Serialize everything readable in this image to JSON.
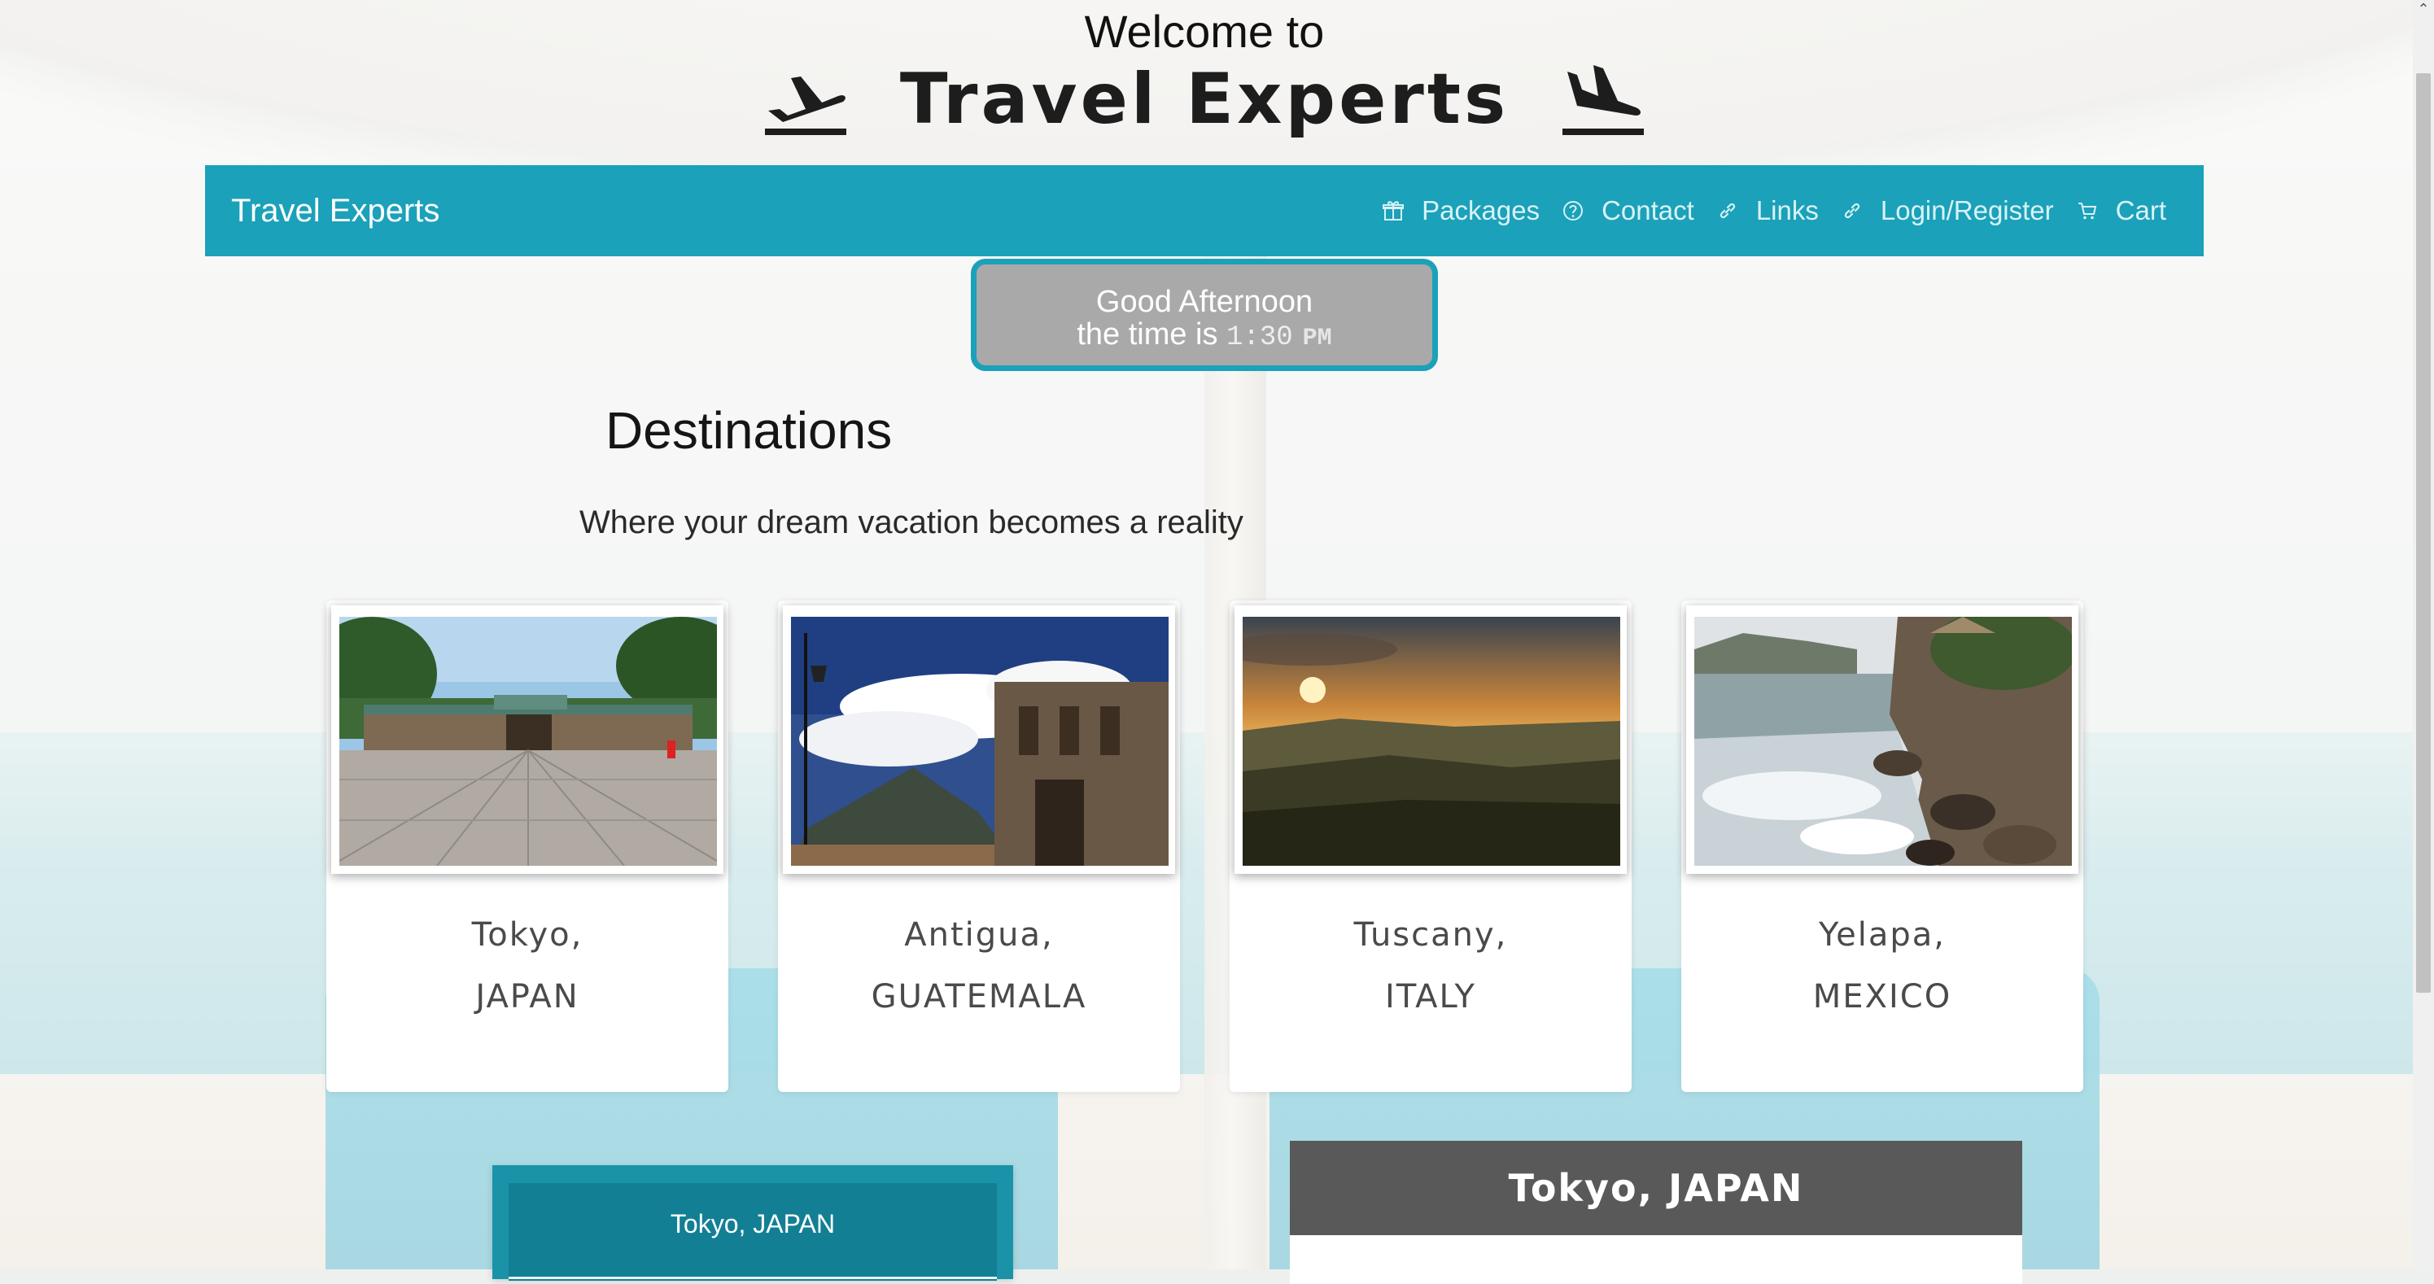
{
  "header": {
    "welcome": "Welcome to",
    "title": "Travel Experts"
  },
  "navbar": {
    "brand": "Travel Experts",
    "accent_color": "#1ba1b9",
    "links": [
      {
        "label": "Packages",
        "icon": "gift-icon"
      },
      {
        "label": "Contact",
        "icon": "question-circle-icon"
      },
      {
        "label": "Links",
        "icon": "link-icon"
      },
      {
        "label": "Login/Register",
        "icon": "link-icon"
      },
      {
        "label": "Cart",
        "icon": "cart-icon"
      }
    ]
  },
  "greeting": {
    "line1": "Good Afternoon",
    "prefix": "the time is",
    "time": "1:30",
    "ampm": "PM"
  },
  "destinations": {
    "title": "Destinations",
    "subtitle": "Where your dream vacation becomes a reality",
    "cards": [
      {
        "city": "Tokyo,",
        "country": "JAPAN",
        "photo": "temple-courtyard-photo"
      },
      {
        "city": "Antigua,",
        "country": "GUATEMALA",
        "photo": "ruins-volcano-photo"
      },
      {
        "city": "Tuscany,",
        "country": "ITALY",
        "photo": "sunset-hills-photo"
      },
      {
        "city": "Yelapa,",
        "country": "MEXICO",
        "photo": "rocky-coast-photo"
      }
    ]
  },
  "bottom": {
    "left_label": "Tokyo, JAPAN",
    "right_heading": "Tokyo, JAPAN"
  }
}
